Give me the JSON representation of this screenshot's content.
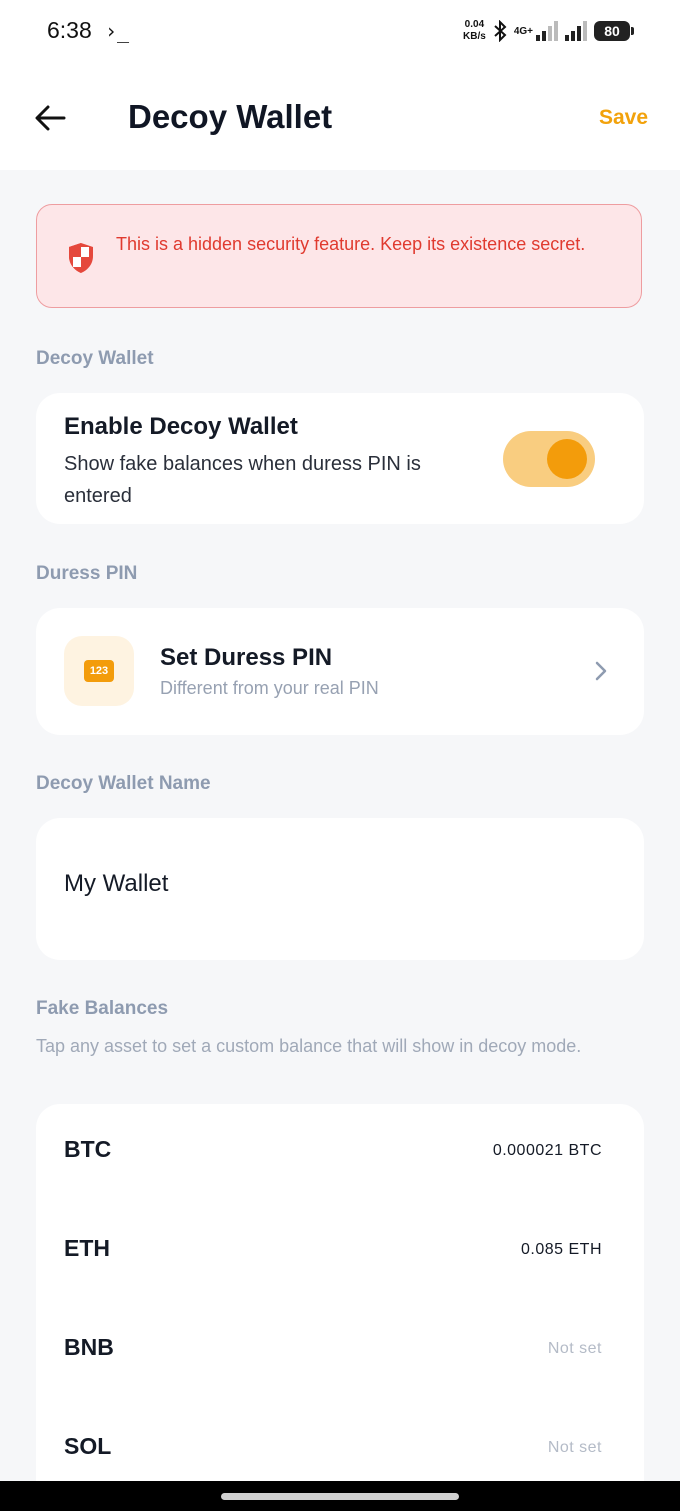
{
  "status_bar": {
    "time": "6:38",
    "terminal_glyph": "›_",
    "speed_value": "0.04",
    "speed_unit": "KB/s",
    "network": "4G+",
    "battery": "80"
  },
  "header": {
    "title": "Decoy Wallet",
    "save_label": "Save"
  },
  "alert": {
    "icon": "shield-icon",
    "text": "This is a hidden security feature. Keep its existence secret.",
    "color": "#e03a2f"
  },
  "decoy_section": {
    "label": "Decoy Wallet",
    "toggle_title": "Enable Decoy Wallet",
    "toggle_description": "Show fake balances when duress PIN is entered",
    "enabled": true
  },
  "duress_section": {
    "label": "Duress PIN",
    "icon_text": "123",
    "title": "Set Duress PIN",
    "subtitle": "Different from your real PIN"
  },
  "name_section": {
    "label": "Decoy Wallet Name",
    "value": "My Wallet"
  },
  "balances_section": {
    "label": "Fake Balances",
    "helper": "Tap any asset to set a custom balance that will show in decoy mode.",
    "assets": [
      {
        "symbol": "BTC",
        "value": "0.000021 BTC"
      },
      {
        "symbol": "ETH",
        "value": "0.085 ETH"
      },
      {
        "symbol": "BNB",
        "value": "Not set"
      },
      {
        "symbol": "SOL",
        "value": "Not set"
      }
    ]
  },
  "colors": {
    "accent": "#f39c0b",
    "alert_bg": "#fde6e8",
    "background": "#f6f7f9"
  }
}
